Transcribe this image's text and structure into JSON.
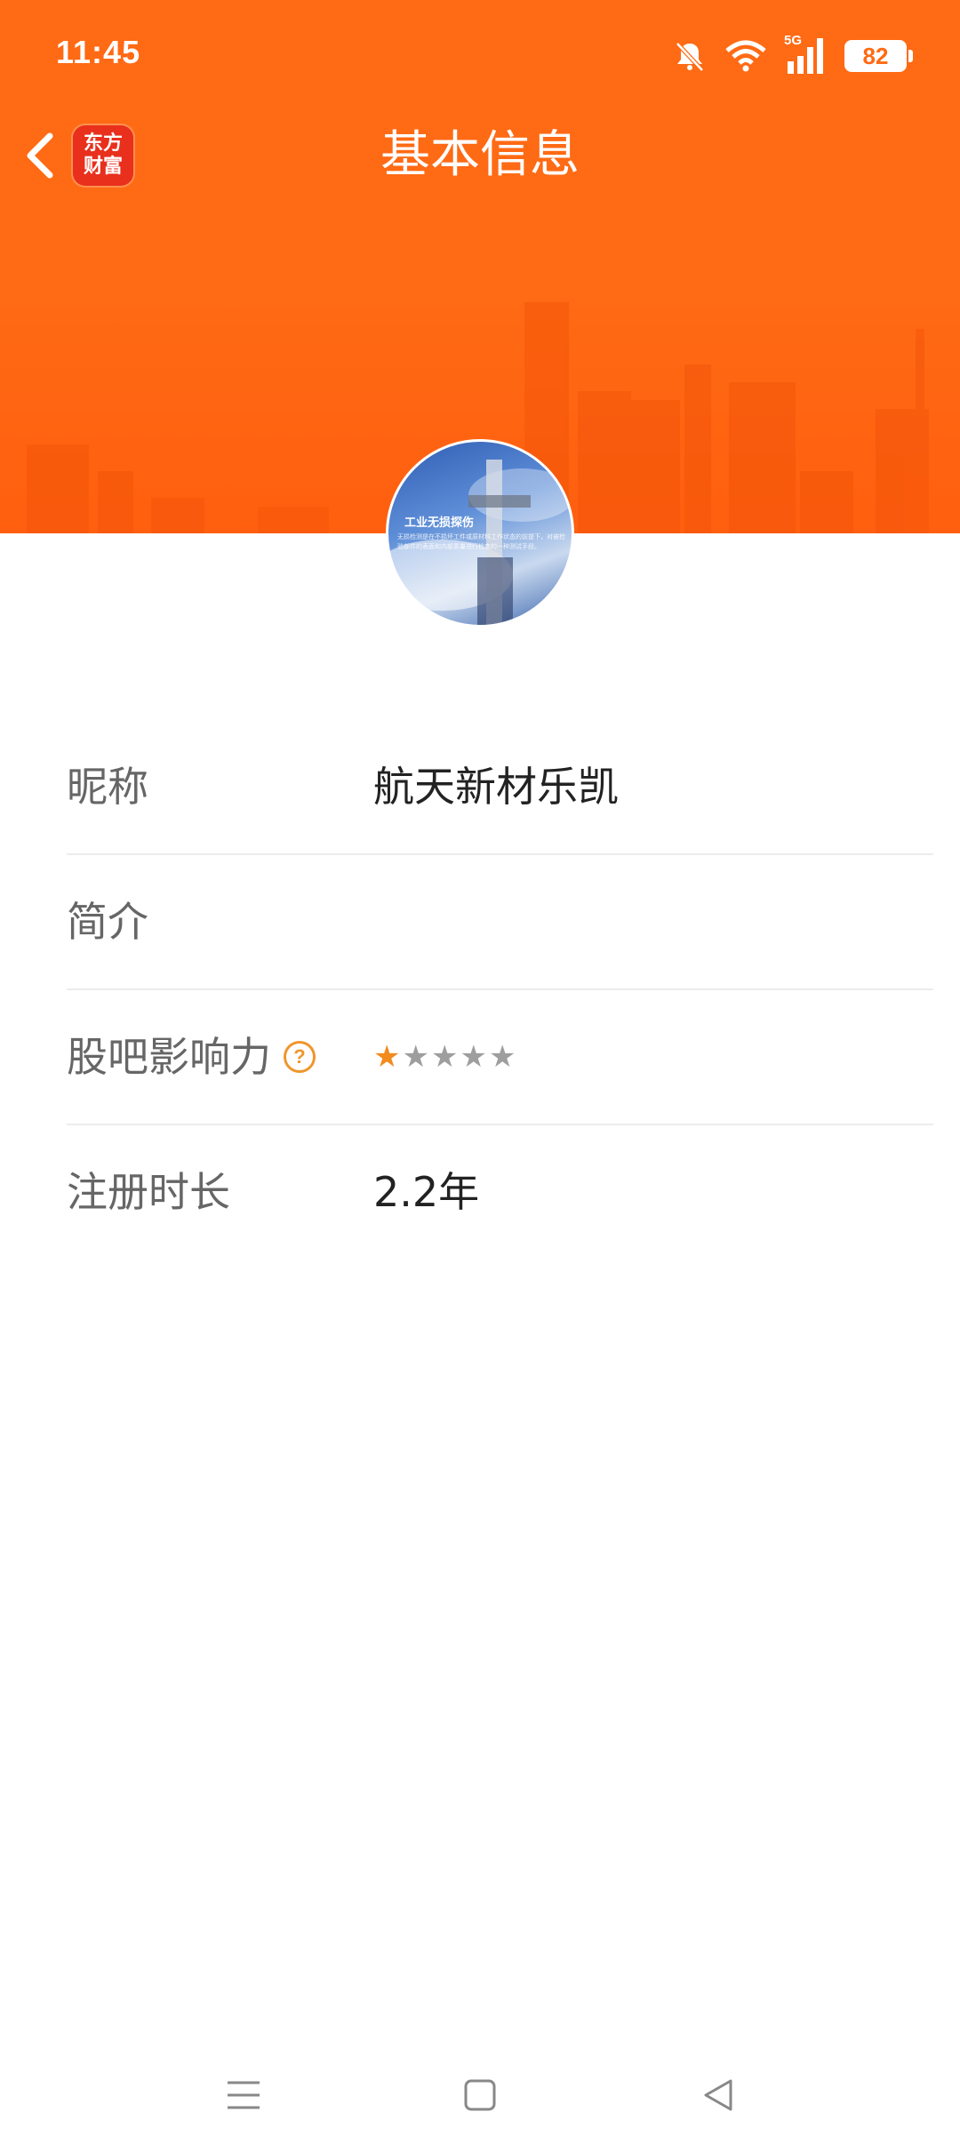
{
  "status_bar": {
    "time": "11:45",
    "network_label": "5G",
    "battery_level": "82",
    "icons": [
      "bell-muted-icon",
      "wifi-icon",
      "cellular-signal-icon",
      "battery-icon"
    ]
  },
  "header": {
    "title": "基本信息",
    "back_icon": "chevron-left-icon",
    "logo_line1": "东方",
    "logo_line2": "财富",
    "accent_color": "#ff6a14"
  },
  "avatar": {
    "title_text": "工业无损探伤",
    "body_text": "无损检测是在不损坏工件或原材料工作状态的前提下，对被检验部件的表面和内部质量进行检查的一种测试手段。"
  },
  "profile": {
    "rows": [
      {
        "label": "昵称",
        "value": "航天新材乐凯"
      },
      {
        "label": "简介",
        "value": ""
      },
      {
        "label": "股吧影响力",
        "help_icon": "question-circle-icon",
        "rating": 1,
        "rating_max": 5
      },
      {
        "label": "注册时长",
        "value": "2.2年"
      }
    ],
    "star_colors": {
      "filled": "#f28a1e",
      "empty": "#9e9e9e"
    }
  },
  "bottom_nav": {
    "icons": [
      "menu-icon",
      "home-square-icon",
      "back-triangle-icon"
    ]
  }
}
